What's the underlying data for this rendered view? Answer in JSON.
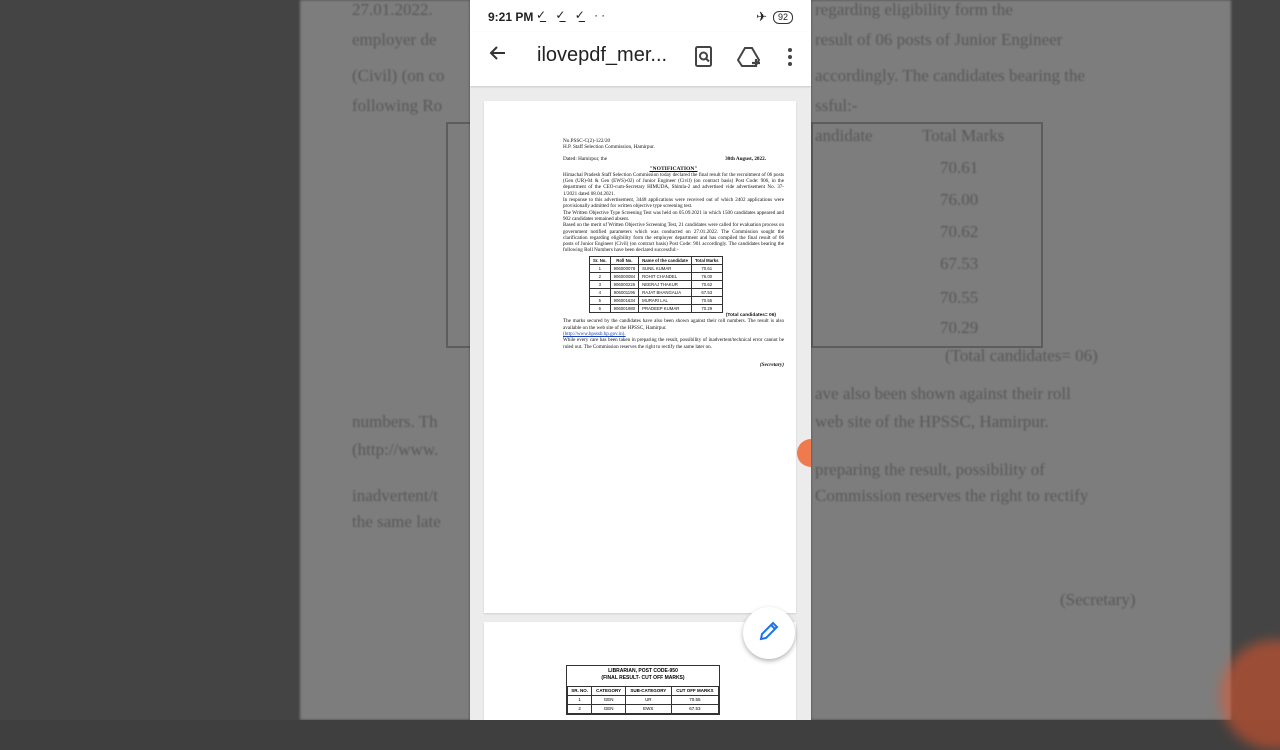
{
  "status_bar": {
    "time": "9:21 PM",
    "notif_icons": [
      "check-icon",
      "check-icon",
      "check-icon",
      "more-dots-icon"
    ],
    "battery": "92"
  },
  "app_bar": {
    "title": "ilovepdf_mer..."
  },
  "background": {
    "lines": [
      "27.01.2022.",
      "regarding eligibility form the",
      "employer de",
      "result of 06 posts of Junior Engineer",
      "(Civil) (on co",
      "accordingly. The candidates bearing the",
      "following Ro",
      "ssful:-",
      "andidate",
      "Total Marks",
      "70.61",
      "76.00",
      "70.62",
      "67.53",
      "70.55",
      "70.29",
      "(Total candidates= 06)",
      "ave also been shown against their roll",
      "numbers. Th",
      "web site of the HPSSC, Hamirpur.",
      "(http://www.",
      "preparing the result, possibility of",
      "inadvertent/t",
      "Commission reserves the right to rectify",
      "the same late",
      "(Secretary)"
    ]
  },
  "doc": {
    "ref_no": "No.PSSC-C(2)-122/20",
    "office": "H.P. Staff Selection Commission, Hamirpur.",
    "dated_label": "Dated: Hamirpur, the",
    "dated_value": "30th August, 2022.",
    "heading": "\"NOTIFICATION\"",
    "para1": "Himachal Pradesh Staff Selection Commission today declared the final result for the recruitment of 06 posts (Gen (UR)-04 & Gen (EWS)-02) of Junior Engineer (Civil) (on contract basis) Post Code: 906, in the department of the CEO-cum-Secretary HIMUDA, Shimla-2 and advertised vide advertisement No. 37-1/2021 dated 08.04.2021.",
    "para2": "In response to this advertisement, 3448 applications were received out of which 2402 applications were provisionally admitted for written objective type screening test.",
    "para3": "The Written Objective Type Screening Test was held on 05.09.2021 in which 1500 candidates appeared and 902 candidates remained absent.",
    "para4": "Based on the merit of Written Objective Screening Test, 21 candidates were called for evaluation process on government notified parameters which was conducted on 27.01.2022. The Commission sought the clarification regarding eligibility form the employer department and has compiled the final result of 06 posts of Junior Engineer (Civil) (on contract basis) Post Code: 901 accordingly. The candidates bearing the following Roll Numbers have been declared successful:-",
    "table_headers": [
      "Sr. No.",
      "Roll No.",
      "Name of the candidate",
      "Total Marks"
    ],
    "table_rows": [
      [
        "1",
        "906000078",
        "SUNIL KUMAR",
        "70.61"
      ],
      [
        "2",
        "906000084",
        "ROHIT CHANDEL",
        "76.00"
      ],
      [
        "3",
        "906000226",
        "NEERAJ THAKUR",
        "70.62"
      ],
      [
        "4",
        "906001196",
        "RAJAT BHANGALIA",
        "67.53"
      ],
      [
        "5",
        "906001634",
        "MURARI LAL",
        "70.55"
      ],
      [
        "6",
        "906001980",
        "PRADEEP KUMAR",
        "70.29"
      ]
    ],
    "total_note": "(Total candidates= 06)",
    "para5": "The marks secured by the candidates have also been shown against their roll numbers. The result is also available on the web site of the HPSSC, Hamirpur.",
    "link": "(http://www.hpsssb.hp.gov.in).",
    "para6": "While every care has been taken in preparing the result, possibility of inadvertent/technical error cannot be ruled out. The Commission reserves the right to rectify the same later on.",
    "signature": "(Secretary)"
  },
  "page2": {
    "title1": "LIBRARIAN, POST CODE-950",
    "title2": "(FINAL RESULT- CUT OFF MARKS)",
    "headers": [
      "SR. NO.",
      "CATEGORY",
      "SUB-CATEGORY",
      "CUT OFF MARKS"
    ],
    "rows": [
      [
        "1",
        "GEN",
        "UR",
        "70.55"
      ],
      [
        "2",
        "GEN",
        "EWS",
        "67.53"
      ]
    ]
  },
  "fab": {
    "icon": "pencil-icon"
  }
}
